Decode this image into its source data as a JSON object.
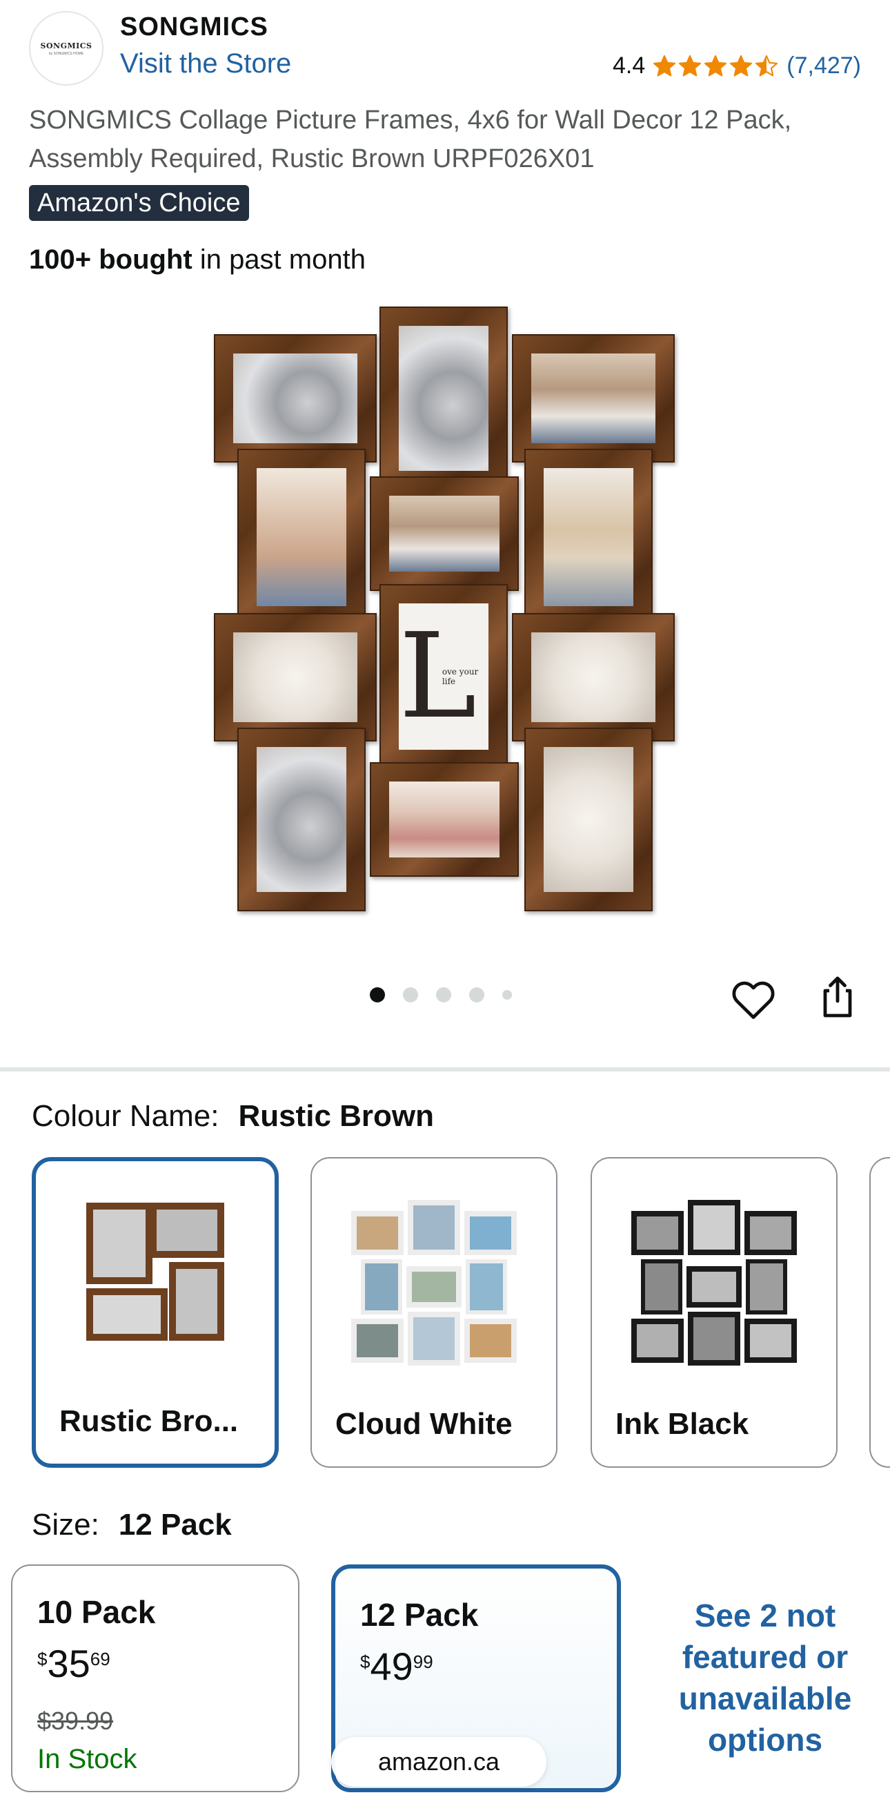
{
  "brand": {
    "logo_text": "SONGMICS",
    "logo_subtext": "by SONGMICS HOME",
    "name": "SONGMICS",
    "visit_store": "Visit the Store"
  },
  "rating": {
    "value": "4.4",
    "stars": 4.5,
    "count": "(7,427)",
    "star_color": "#f08804"
  },
  "product": {
    "title": "SONGMICS Collage Picture Frames, 4x6 for Wall Decor 12 Pack, Assembly Required, Rustic Brown URPF026X01",
    "badge": "Amazon's Choice",
    "bought_bold": "100+ bought",
    "bought_rest": " in past month",
    "image_poster_letter": "L",
    "image_poster_text": "ove your life"
  },
  "carousel": {
    "total": 5,
    "active_index": 0
  },
  "actions": {
    "wishlist_icon": "heart-icon",
    "share_icon": "share-icon"
  },
  "colour": {
    "label": "Colour Name:",
    "selected": "Rustic Brown",
    "options": [
      {
        "label": "Rustic Bro...",
        "color": "#6d4020"
      },
      {
        "label": "Cloud White",
        "color": "#f5f5f5"
      },
      {
        "label": "Ink Black",
        "color": "#1a1a1a"
      }
    ]
  },
  "size": {
    "label": "Size:",
    "selected": "12 Pack",
    "options": [
      {
        "name": "10 Pack",
        "price_currency": "$",
        "price_whole": "35",
        "price_fraction": "69",
        "list_price": "$39.99",
        "availability": "In Stock"
      },
      {
        "name": "12 Pack",
        "price_currency": "$",
        "price_whole": "49",
        "price_fraction": "99"
      }
    ],
    "more_options": "See 2 not featured or unavailable options"
  },
  "browser": {
    "url": "amazon.ca"
  },
  "colors": {
    "link": "#2162a1",
    "badge_bg": "#232f3e",
    "in_stock": "#007600",
    "selected_border": "#2162a1"
  }
}
